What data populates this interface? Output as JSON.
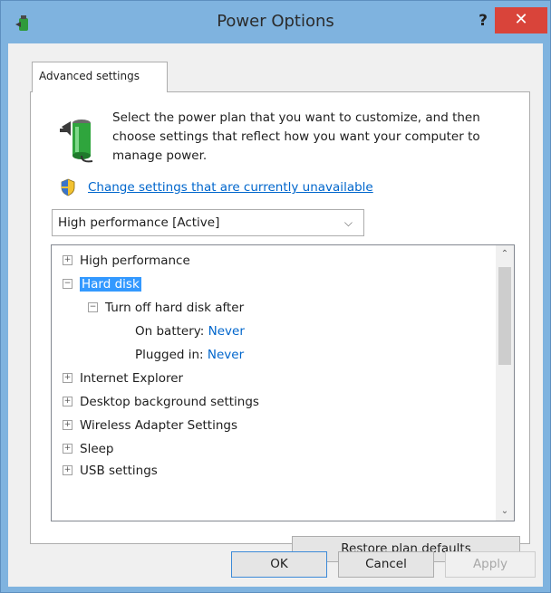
{
  "window": {
    "title": "Power Options",
    "help_label": "?",
    "close_label": "✕"
  },
  "tab": {
    "label": "Advanced settings"
  },
  "intro": {
    "text": "Select the power plan that you want to customize, and then choose settings that reflect how you want your computer to manage power."
  },
  "change_link": {
    "label": "Change settings that are currently unavailable"
  },
  "plan_select": {
    "value": "High performance [Active]"
  },
  "tree": {
    "high_performance": {
      "expander": "+",
      "label": "High performance"
    },
    "hard_disk": {
      "expander": "−",
      "label": "Hard disk"
    },
    "turn_off": {
      "expander": "−",
      "label": "Turn off hard disk after"
    },
    "on_battery": {
      "label": "On battery:",
      "value": "Never"
    },
    "plugged_in": {
      "label": "Plugged in:",
      "value": "Never"
    },
    "internet_explorer": {
      "expander": "+",
      "label": "Internet Explorer"
    },
    "desktop_background": {
      "expander": "+",
      "label": "Desktop background settings"
    },
    "wireless_adapter": {
      "expander": "+",
      "label": "Wireless Adapter Settings"
    },
    "sleep": {
      "expander": "+",
      "label": "Sleep"
    },
    "usb_settings": {
      "expander": "+",
      "label": "USB settings"
    }
  },
  "buttons": {
    "restore": "Restore plan defaults",
    "ok": "OK",
    "cancel": "Cancel",
    "apply": "Apply"
  },
  "colors": {
    "title_bar": "#7fb3df",
    "close_button": "#d9443a",
    "link": "#0066cc",
    "selection": "#3399ff"
  },
  "icons": {
    "app": "power-options-icon",
    "intro": "battery-plug-icon",
    "link": "uac-shield-icon"
  }
}
